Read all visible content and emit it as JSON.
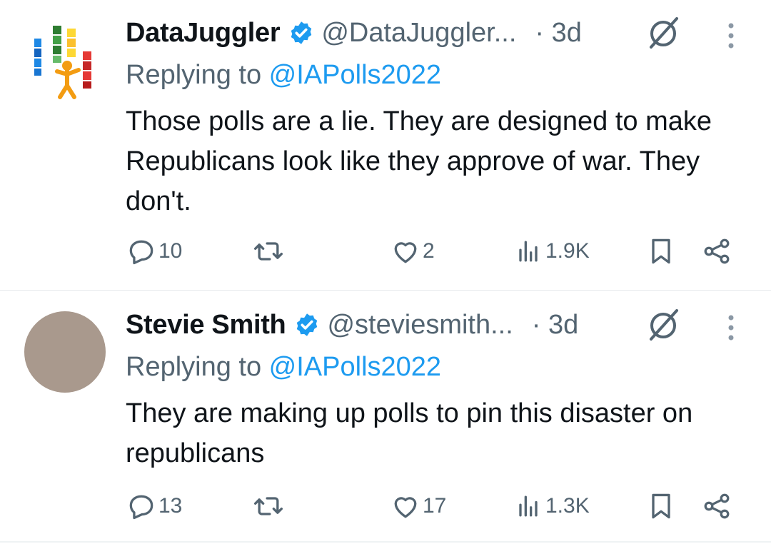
{
  "tweets": [
    {
      "display_name": "DataJuggler",
      "handle": "@DataJuggler...",
      "separator_time": "· 3d",
      "replying_prefix": "Replying to ",
      "replying_handle": "@IAPolls2022",
      "text": "Those polls are a lie. They are designed to make Republicans look like they approve of war. They don't.",
      "avatar_icon": "juggler-puzzle-avatar",
      "stats": {
        "replies": "10",
        "likes": "2",
        "views": "1.9K"
      }
    },
    {
      "display_name": "Stevie Smith",
      "handle": "@steviesmith...",
      "separator_time": "· 3d",
      "replying_prefix": "Replying to ",
      "replying_handle": "@IAPolls2022",
      "text": "They are making up polls to pin this disaster on republicans",
      "avatar_icon": "default-avatar",
      "stats": {
        "replies": "13",
        "likes": "17",
        "views": "1.3K"
      }
    }
  ],
  "colors": {
    "text": "#0f1419",
    "secondary": "#536471",
    "accent": "#1d9bf0",
    "divider": "#e6e9ec"
  }
}
